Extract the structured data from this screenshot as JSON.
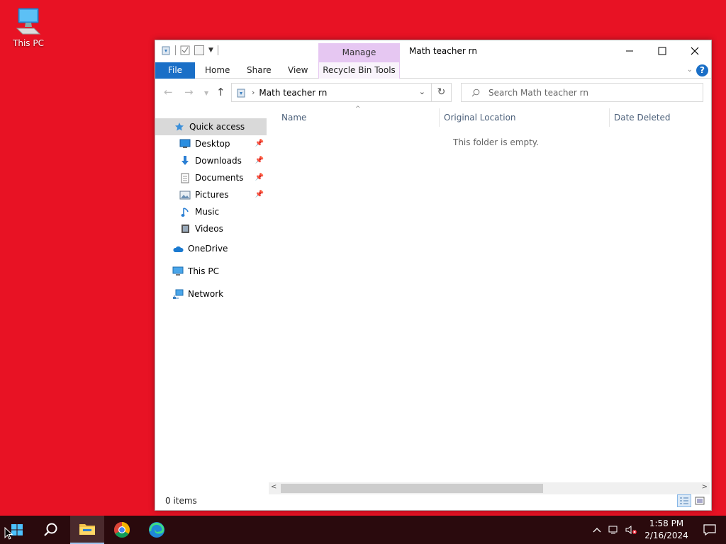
{
  "desktop": {
    "this_pc_label": "This PC"
  },
  "window": {
    "title": "Math teacher rn",
    "context_tab": "Manage",
    "ribbon_tabs": {
      "file": "File",
      "home": "Home",
      "share": "Share",
      "view": "View",
      "tools": "Recycle Bin Tools"
    },
    "address": {
      "path": "Math teacher rn"
    },
    "search": {
      "placeholder": "Search Math teacher rn"
    },
    "nav": {
      "quick_access": "Quick access",
      "desktop": "Desktop",
      "downloads": "Downloads",
      "documents": "Documents",
      "pictures": "Pictures",
      "music": "Music",
      "videos": "Videos",
      "onedrive": "OneDrive",
      "this_pc": "This PC",
      "network": "Network"
    },
    "columns": {
      "name": "Name",
      "original_location": "Original Location",
      "date_deleted": "Date Deleted"
    },
    "empty_message": "This folder is empty.",
    "status": {
      "item_count": "0 items"
    }
  },
  "taskbar": {
    "clock": {
      "time": "1:58 PM",
      "date": "2/16/2024"
    },
    "icons": [
      "windows-start-icon",
      "search-icon",
      "file-explorer-icon",
      "chrome-icon",
      "edge-icon"
    ]
  },
  "colors": {
    "desktop": "#e81224",
    "accent": "#1a6fc7",
    "manage_tab": "#e6c7f2",
    "taskbar": "#2a0a0d"
  }
}
